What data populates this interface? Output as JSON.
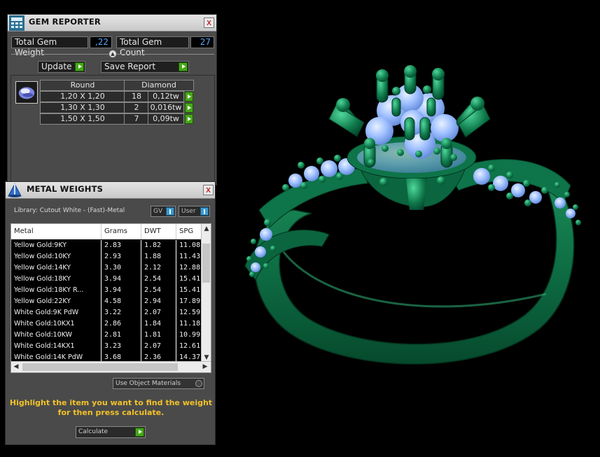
{
  "gem_reporter": {
    "title": "GEM REPORTER",
    "close_label": "x",
    "total_weight_label": "Total Gem Weight",
    "total_weight_value": ",22",
    "total_count_label": "Total Gem Count",
    "total_count_value": "27",
    "update_label": "Update",
    "save_report_label": "Save Report",
    "table": {
      "shape_header": "Round",
      "material_header": "Diamond",
      "rows": [
        {
          "size": "1,20 X 1,20",
          "count": "18",
          "weight": "0,12tw"
        },
        {
          "size": "1,30 X 1,30",
          "count": "2",
          "weight": "0,016tw"
        },
        {
          "size": "1,50 X 1,50",
          "count": "7",
          "weight": "0,09tw"
        }
      ]
    }
  },
  "metal_weights": {
    "title": "METAL WEIGHTS",
    "close_label": "x",
    "library_text": "Library: Cutout White - (Fast)-Metal",
    "gv_label": "GV",
    "user_label": "User",
    "columns": [
      "Metal",
      "Grams",
      "DWT",
      "SPG"
    ],
    "rows": [
      [
        "Yellow Gold:9KY",
        "2.83",
        "1.82",
        "11.08"
      ],
      [
        "Yellow Gold:10KY",
        "2.93",
        "1.88",
        "11.43"
      ],
      [
        "Yellow Gold:14KY",
        "3.30",
        "2.12",
        "12.88"
      ],
      [
        "Yellow Gold:18KY",
        "3.94",
        "2.54",
        "15.41"
      ],
      [
        "Yellow Gold:18KY R...",
        "3.94",
        "2.54",
        "15.41"
      ],
      [
        "Yellow Gold:22KY",
        "4.58",
        "2.94",
        "17.89"
      ],
      [
        "White Gold:9K PdW",
        "3.22",
        "2.07",
        "12.59"
      ],
      [
        "White Gold:10KX1",
        "2.86",
        "1.84",
        "11.18"
      ],
      [
        "White Gold:10KW",
        "2.81",
        "1.81",
        "10.99"
      ],
      [
        "White Gold:14KX1",
        "3.23",
        "2.07",
        "12.61"
      ],
      [
        "White Gold:14K PdW",
        "3.68",
        "2.36",
        "14.37"
      ]
    ],
    "use_object_materials_label": "Use Object Materials",
    "hint_line1": "Highlight the item you want to find the weight",
    "hint_line2": "for then press calculate.",
    "calculate_label": "Calculate"
  },
  "colors": {
    "metal_green": "#0f6b44",
    "gem_blue": "#8ab8ff",
    "value_blue": "#58a8ff",
    "hint_yellow": "#f2c22a",
    "button_green": "#46a817"
  }
}
